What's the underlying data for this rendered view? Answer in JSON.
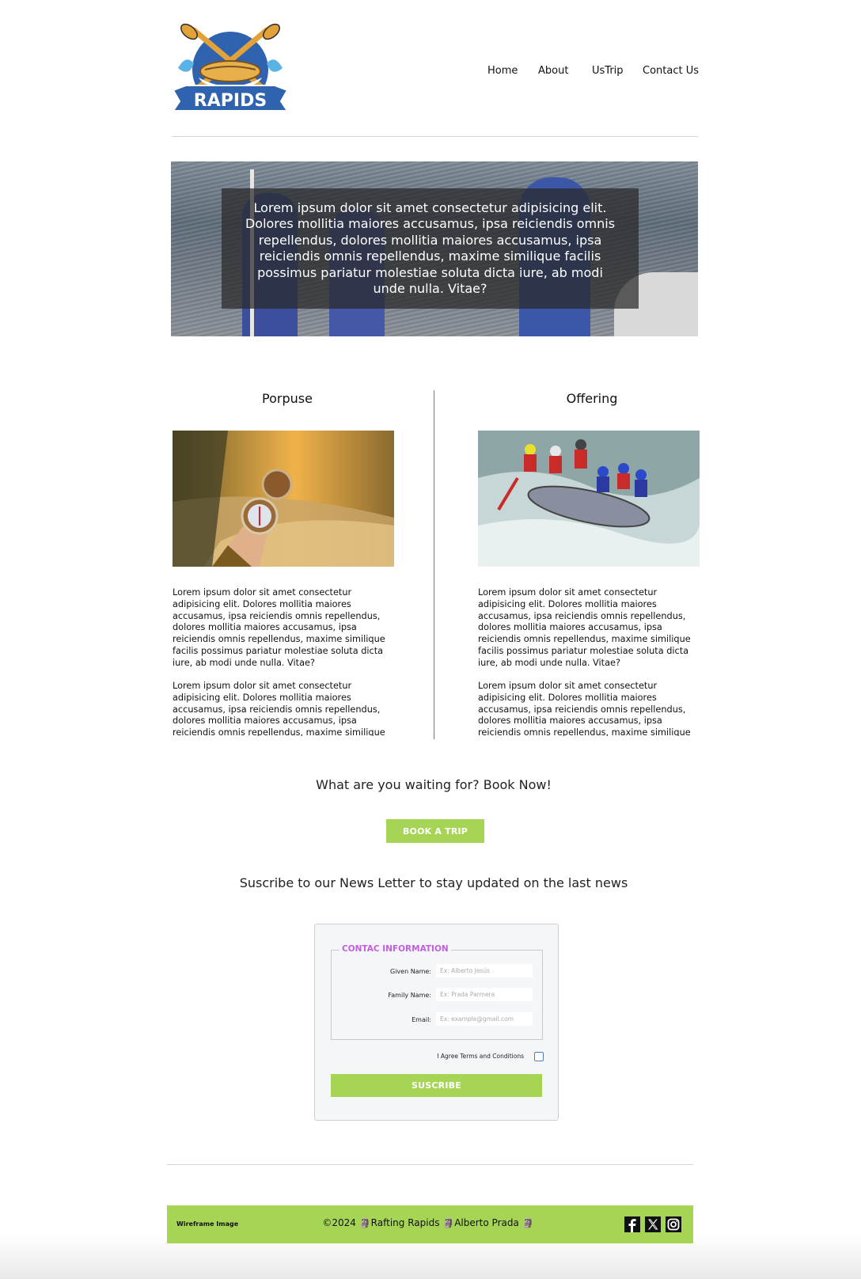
{
  "brand": {
    "logo_text": "RAPIDS"
  },
  "nav": {
    "items": [
      "Home",
      "About",
      "UsTrip",
      "Contact Us"
    ]
  },
  "hero": {
    "text": "Lorem ipsum dolor sit amet consectetur adipisicing elit. Dolores mollitia maiores accusamus, ipsa reiciendis omnis repellendus, dolores mollitia maiores accusamus, ipsa reiciendis omnis repellendus, maxime similique facilis possimus pariatur molestiae soluta dicta iure, ab modi unde nulla. Vitae?"
  },
  "sections": [
    {
      "title": "Porpuse",
      "p1": "Lorem ipsum dolor sit amet consectetur adipisicing elit. Dolores mollitia maiores accusamus, ipsa reiciendis omnis repellendus, dolores mollitia maiores accusamus, ipsa reiciendis omnis repellendus, maxime similique facilis possimus pariatur molestiae soluta dicta iure, ab modi unde nulla. Vitae?",
      "p2": "Lorem ipsum dolor sit amet consectetur adipisicing elit. Dolores mollitia maiores accusamus, ipsa reiciendis omnis repellendus, dolores mollitia maiores accusamus, ipsa reiciendis omnis repellendus, maxime similique"
    },
    {
      "title": "Offering",
      "p1": "Lorem ipsum dolor sit amet consectetur adipisicing elit. Dolores mollitia maiores accusamus, ipsa reiciendis omnis repellendus, dolores mollitia maiores accusamus, ipsa reiciendis omnis repellendus, maxime similique facilis possimus pariatur molestiae soluta dicta iure, ab modi unde nulla. Vitae?",
      "p2": "Lorem ipsum dolor sit amet consectetur adipisicing elit. Dolores mollitia maiores accusamus, ipsa reiciendis omnis repellendus, dolores mollitia maiores accusamus, ipsa reiciendis omnis repellendus, maxime similique"
    }
  ],
  "cta": {
    "text": "What are you waiting for? Book Now!",
    "button": "BOOK A TRIP"
  },
  "newsletter": {
    "heading": "Suscribe to our News Letter to stay updated on the last news",
    "legend": "CONTAC INFORMATION",
    "fields": [
      {
        "label": "Given Name:",
        "placeholder": "Ex: Alberto Jesús"
      },
      {
        "label": "Family Name:",
        "placeholder": "Ex: Prada Parmera"
      },
      {
        "label": "Email:",
        "placeholder": "Ex: example@gmail.com"
      }
    ],
    "agree": "I Agree Terms and Conditions",
    "submit": "SUSCRIBE"
  },
  "footer": {
    "left": "Wireframe Image",
    "center": "©2024 🗿Rafting Rapids 🗿Alberto Prada 🗿",
    "social_icons": [
      "facebook-icon",
      "x-icon",
      "instagram-icon"
    ]
  },
  "colors": {
    "accent": "#a6d556",
    "legend": "#c35ee0",
    "logo_blue": "#2f63b0",
    "oar": "#e2a23a"
  }
}
